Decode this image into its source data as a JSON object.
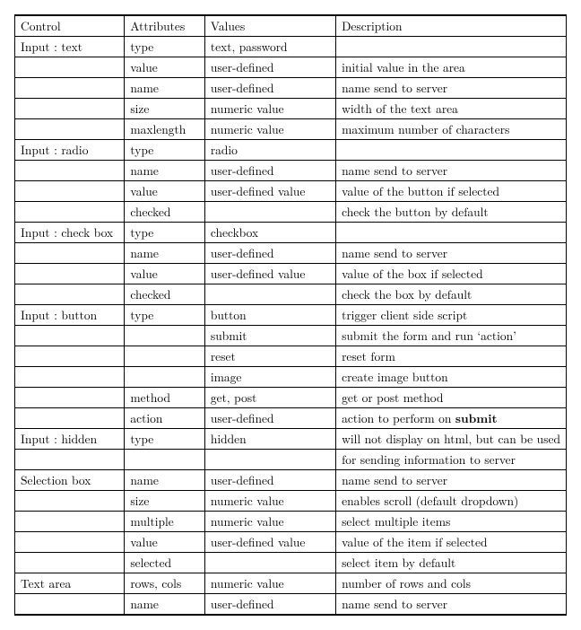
{
  "headers": [
    "Control",
    "Attributes",
    "Values",
    "Description"
  ],
  "rows": [
    [
      "Input : text",
      "type",
      "text, password",
      ""
    ],
    [
      "",
      "value",
      "user-defined",
      "initial value in the area"
    ],
    [
      "",
      "name",
      "user-defined",
      "name send to server"
    ],
    [
      "",
      "size",
      "numeric value",
      "width of the text area"
    ],
    [
      "",
      "maxlength",
      "numeric value",
      "maximum number of characters"
    ],
    [
      "Input : radio",
      "type",
      "radio",
      ""
    ],
    [
      "",
      "name",
      "user-defined",
      "name send to server"
    ],
    [
      "",
      "value",
      "user-defined value",
      "value of the button if selected"
    ],
    [
      "",
      "checked",
      "",
      "check the button by default"
    ],
    [
      "Input : check box",
      "type",
      "checkbox",
      ""
    ],
    [
      "",
      "name",
      "user-defined",
      "name send to server"
    ],
    [
      "",
      "value",
      "user-defined value",
      "value of the box if selected"
    ],
    [
      "",
      "checked",
      "",
      "check the box by default"
    ],
    [
      "Input : button",
      "type",
      "button",
      "trigger client side script"
    ],
    [
      "",
      "",
      "submit",
      "submit the form and run ‘action’"
    ],
    [
      "",
      "",
      "reset",
      "reset form"
    ],
    [
      "",
      "",
      "image",
      "create image button"
    ],
    [
      "",
      "method",
      "get, post",
      "get or post method"
    ],
    [
      "",
      "action",
      "user-defined",
      "action to perform on <b>submit</b>"
    ],
    [
      "Input : hidden",
      "type",
      "hidden",
      "will not display on html, but can be used"
    ],
    [
      "",
      "",
      "",
      "for sending information to server"
    ],
    [
      "Selection box",
      "name",
      "user-defined",
      "name send to server"
    ],
    [
      "",
      "size",
      "numeric value",
      "enables scroll (default dropdown)"
    ],
    [
      "",
      "multiple",
      "numeric value",
      "select multiple items"
    ],
    [
      "",
      "value",
      "user-defined value",
      "value of the item if selected"
    ],
    [
      "",
      "selected",
      "",
      "select item by default"
    ],
    [
      "Text area",
      "rows, cols",
      "numeric value",
      "number of rows and cols"
    ],
    [
      "",
      "name",
      "user-defined",
      "name send to server"
    ]
  ]
}
